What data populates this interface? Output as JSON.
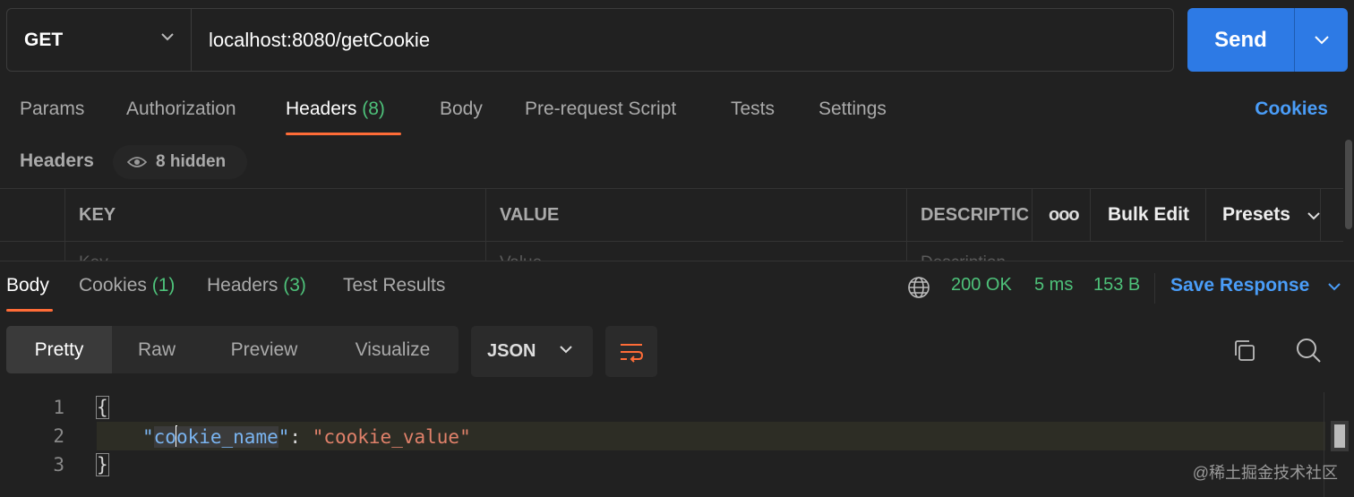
{
  "request": {
    "method": "GET",
    "url": "localhost:8080/getCookie",
    "send_label": "Send"
  },
  "request_tabs": {
    "params": "Params",
    "authorization": "Authorization",
    "headers": "Headers",
    "headers_count": "(8)",
    "body": "Body",
    "pre_request": "Pre-request Script",
    "tests": "Tests",
    "settings": "Settings",
    "cookies": "Cookies"
  },
  "headers_section": {
    "title": "Headers",
    "hidden": "8 hidden",
    "columns": {
      "key": "KEY",
      "value": "VALUE",
      "description": "DESCRIPTIC"
    },
    "placeholders": {
      "key": "Key",
      "value": "Value",
      "description": "Description"
    },
    "more": "ooo",
    "bulk_edit": "Bulk Edit",
    "presets": "Presets"
  },
  "response_tabs": {
    "body": "Body",
    "cookies": "Cookies",
    "cookies_count": "(1)",
    "headers": "Headers",
    "headers_count": "(3)",
    "test_results": "Test Results"
  },
  "response_meta": {
    "status": "200 OK",
    "time": "5 ms",
    "size": "153 B",
    "save": "Save Response"
  },
  "view_modes": [
    "Pretty",
    "Raw",
    "Preview",
    "Visualize"
  ],
  "format": "JSON",
  "code": {
    "line_numbers": [
      "1",
      "2",
      "3"
    ],
    "open_brace": "{",
    "close_brace": "}",
    "quote": "\"",
    "key_part1": "co",
    "key_part2": "okie_name",
    "colon": ": ",
    "value": "\"cookie_value\""
  },
  "watermark": "@稀土掘金技术社区",
  "colors": {
    "accent_orange": "#ff6c37",
    "send_blue": "#2d7ae5",
    "link_blue": "#4a9df8",
    "count_green": "#4ec27a"
  },
  "icons": [
    "chevron-down-icon",
    "eye-icon",
    "globe-icon",
    "wrap-lines-icon",
    "copy-icon",
    "search-icon"
  ]
}
